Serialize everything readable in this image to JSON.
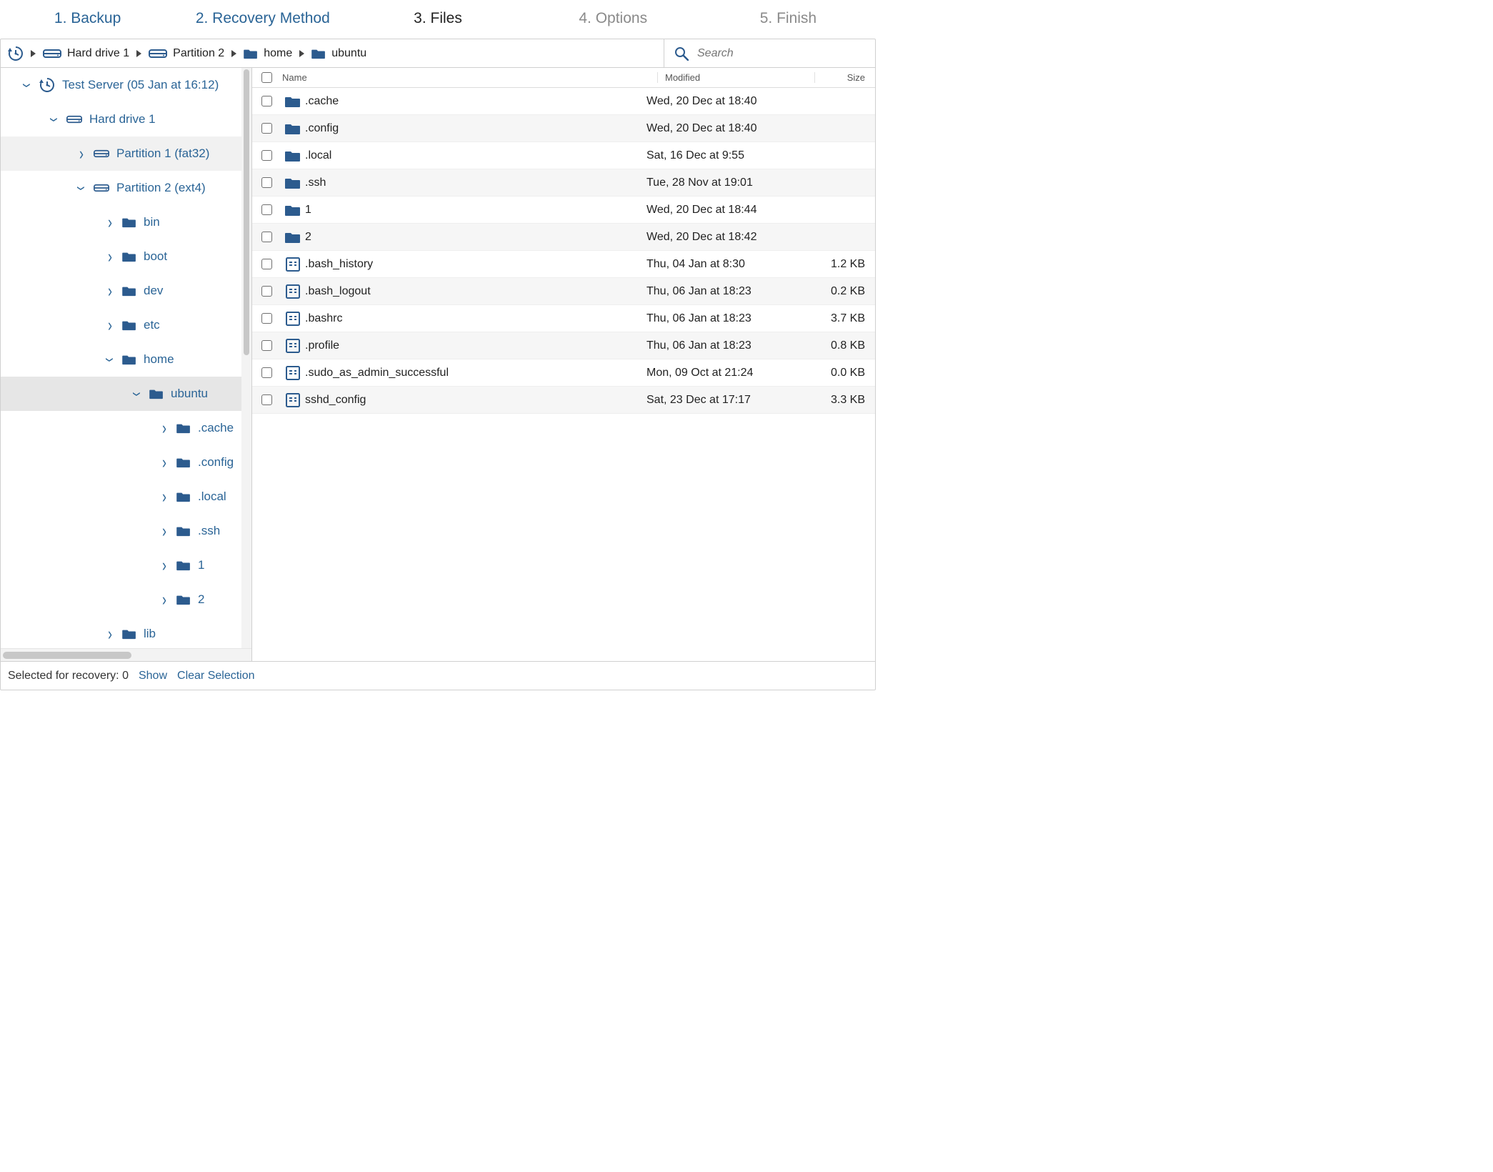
{
  "steps": {
    "s1": "1. Backup",
    "s2": "2. Recovery Method",
    "s3": "3. Files",
    "s4": "4. Options",
    "s5": "5. Finish"
  },
  "breadcrumb": {
    "c1": "Hard drive 1",
    "c2": "Partition 2",
    "c3": "home",
    "c4": "ubuntu"
  },
  "search": {
    "placeholder": "Search"
  },
  "tree": {
    "root": "Test Server (05 Jan at 16:12)",
    "drive1": "Hard drive 1",
    "part1": "Partition 1 (fat32)",
    "part2": "Partition 2 (ext4)",
    "bin": "bin",
    "boot": "boot",
    "dev": "dev",
    "etc": "etc",
    "home": "home",
    "ubuntu": "ubuntu",
    "cache": ".cache",
    "config": ".config",
    "local": ".local",
    "ssh": ".ssh",
    "one": "1",
    "two": "2",
    "lib": "lib"
  },
  "columns": {
    "name": "Name",
    "modified": "Modified",
    "size": "Size"
  },
  "files": [
    {
      "type": "folder",
      "name": ".cache",
      "modified": "Wed, 20 Dec at 18:40",
      "size": ""
    },
    {
      "type": "folder",
      "name": ".config",
      "modified": "Wed, 20 Dec at 18:40",
      "size": ""
    },
    {
      "type": "folder",
      "name": ".local",
      "modified": "Sat, 16 Dec at 9:55",
      "size": ""
    },
    {
      "type": "folder",
      "name": ".ssh",
      "modified": "Tue, 28 Nov at 19:01",
      "size": ""
    },
    {
      "type": "folder",
      "name": "1",
      "modified": "Wed, 20 Dec at 18:44",
      "size": ""
    },
    {
      "type": "folder",
      "name": "2",
      "modified": "Wed, 20 Dec at 18:42",
      "size": ""
    },
    {
      "type": "file",
      "name": ".bash_history",
      "modified": "Thu, 04 Jan at 8:30",
      "size": "1.2 KB"
    },
    {
      "type": "file",
      "name": ".bash_logout",
      "modified": "Thu, 06 Jan at 18:23",
      "size": "0.2 KB"
    },
    {
      "type": "file",
      "name": ".bashrc",
      "modified": "Thu, 06 Jan at 18:23",
      "size": "3.7 KB"
    },
    {
      "type": "file",
      "name": ".profile",
      "modified": "Thu, 06 Jan at 18:23",
      "size": "0.8 KB"
    },
    {
      "type": "file",
      "name": ".sudo_as_admin_successful",
      "modified": "Mon, 09 Oct at 21:24",
      "size": "0.0 KB"
    },
    {
      "type": "file",
      "name": "sshd_config",
      "modified": "Sat, 23 Dec at 17:17",
      "size": "3.3 KB"
    }
  ],
  "footer": {
    "label": "Selected for recovery: ",
    "count": "0",
    "show": "Show",
    "clear": "Clear Selection"
  }
}
